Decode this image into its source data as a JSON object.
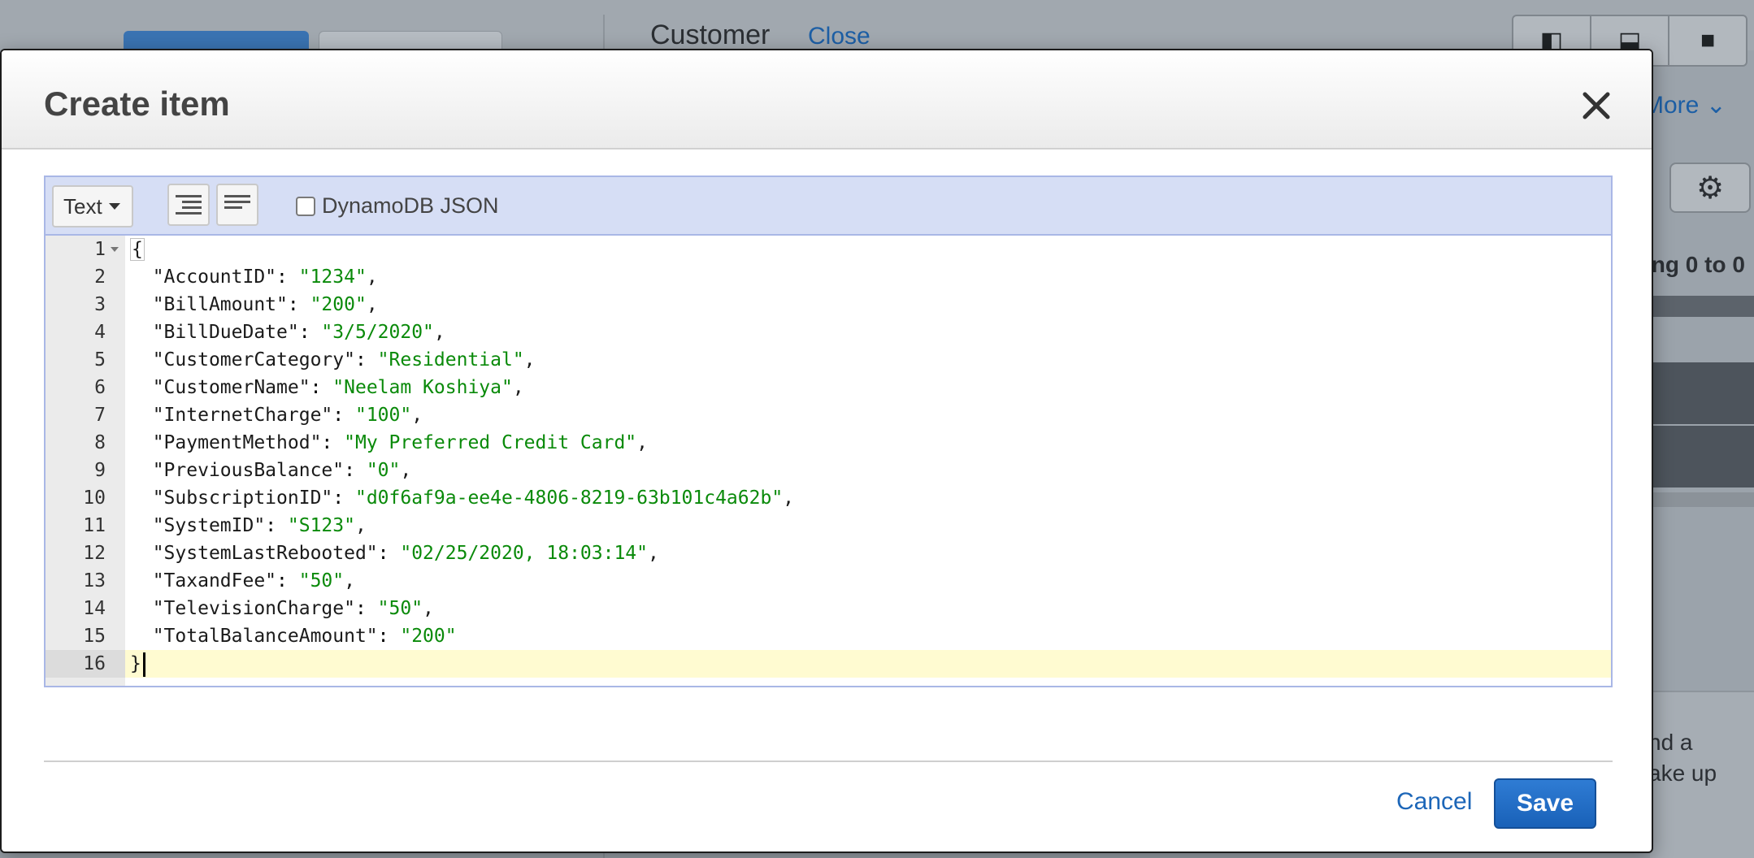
{
  "background": {
    "panel_title": "Customer",
    "panel_close": "Close",
    "more_link": "More",
    "showing_text": "ing 0 to 0",
    "side_text_line1": "nd a",
    "side_text_line2": "ake up"
  },
  "modal": {
    "title": "Create item",
    "toolbar": {
      "mode": "Text",
      "dynamodb_json_label": "DynamoDB JSON",
      "dynamodb_json_checked": false
    },
    "code_lines": [
      {
        "n": "1",
        "text": "{"
      },
      {
        "n": "2",
        "key": "\"AccountID\"",
        "value": "\"1234\"",
        "trail": ","
      },
      {
        "n": "3",
        "key": "\"BillAmount\"",
        "value": "\"200\"",
        "trail": ","
      },
      {
        "n": "4",
        "key": "\"BillDueDate\"",
        "value": "\"3/5/2020\"",
        "trail": ","
      },
      {
        "n": "5",
        "key": "\"CustomerCategory\"",
        "value": "\"Residential\"",
        "trail": ","
      },
      {
        "n": "6",
        "key": "\"CustomerName\"",
        "value": "\"Neelam Koshiya\"",
        "trail": ","
      },
      {
        "n": "7",
        "key": "\"InternetCharge\"",
        "value": "\"100\"",
        "trail": ","
      },
      {
        "n": "8",
        "key": "\"PaymentMethod\"",
        "value": "\"My Preferred Credit Card\"",
        "trail": ","
      },
      {
        "n": "9",
        "key": "\"PreviousBalance\"",
        "value": "\"0\"",
        "trail": ","
      },
      {
        "n": "10",
        "key": "\"SubscriptionID\"",
        "value": "\"d0f6af9a-ee4e-4806-8219-63b101c4a62b\"",
        "trail": ","
      },
      {
        "n": "11",
        "key": "\"SystemID\"",
        "value": "\"S123\"",
        "trail": ","
      },
      {
        "n": "12",
        "key": "\"SystemLastRebooted\"",
        "value": "\"02/25/2020, 18:03:14\"",
        "trail": ","
      },
      {
        "n": "13",
        "key": "\"TaxandFee\"",
        "value": "\"50\"",
        "trail": ","
      },
      {
        "n": "14",
        "key": "\"TelevisionCharge\"",
        "value": "\"50\"",
        "trail": ","
      },
      {
        "n": "15",
        "key": "\"TotalBalanceAmount\"",
        "value": "\"200\"",
        "trail": ""
      },
      {
        "n": "16",
        "text": "}"
      }
    ],
    "footer": {
      "cancel_label": "Cancel",
      "save_label": "Save"
    }
  },
  "colors": {
    "string_value": "#0a8a0a",
    "save_button": "#1d6fc9",
    "link": "#1c66b8",
    "active_line": "#fffbd1"
  }
}
